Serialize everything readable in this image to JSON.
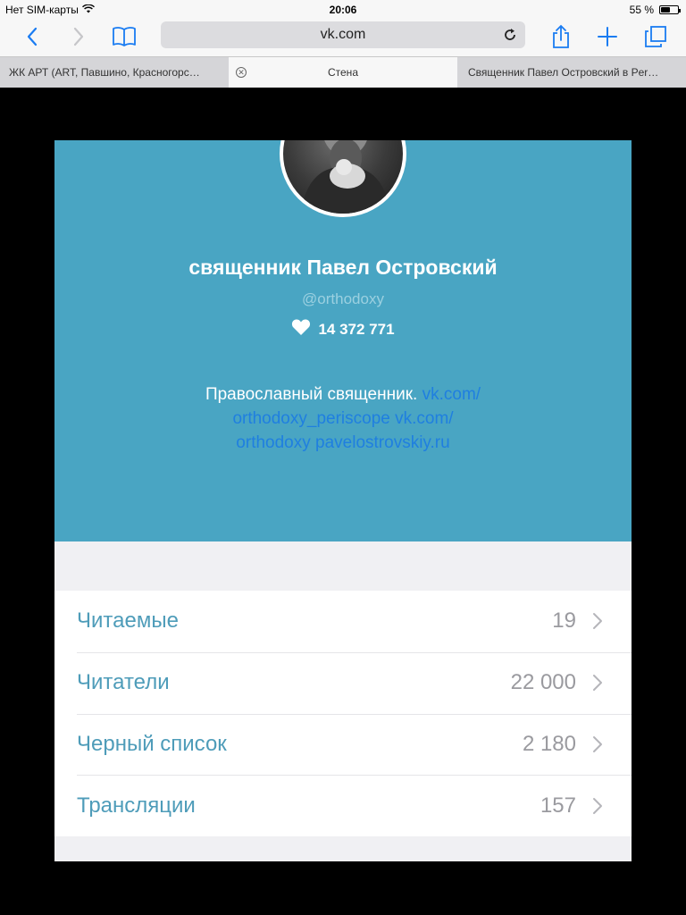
{
  "status_bar": {
    "carrier": "Нет SIM-карты",
    "time": "20:06",
    "battery_percent": "55 %",
    "battery_level": 0.55
  },
  "browser": {
    "url": "vk.com",
    "tabs": [
      {
        "title": "ЖК АРТ (ART, Павшино, Красногорс…",
        "state": "inactive"
      },
      {
        "title": "Стена",
        "state": "active"
      },
      {
        "title": "Священник Павел Островский в Per…",
        "state": "inactive"
      }
    ],
    "icons": {
      "back": "back-chevron-icon",
      "forward": "forward-chevron-icon",
      "bookmarks": "bookmarks-book-icon",
      "reload": "reload-icon",
      "share": "share-icon",
      "new_tab": "plus-icon",
      "tabs": "tabs-overview-icon"
    }
  },
  "profile": {
    "name": "священник Павел Островский",
    "handle": "@orthodoxy",
    "likes": "14 372 771",
    "bio_text": "Православный священник.",
    "bio_link1": "vk.com/",
    "bio_link2": "orthodoxy_periscope",
    "bio_link3": "vk.com/",
    "bio_link4": "orthodoxy",
    "bio_link5": "pavelostrovskiy.ru"
  },
  "stats": [
    {
      "label": "Читаемые",
      "value": "19"
    },
    {
      "label": "Читатели",
      "value": "22 000"
    },
    {
      "label": "Черный список",
      "value": "2 180"
    },
    {
      "label": "Трансляции",
      "value": "157"
    }
  ],
  "colors": {
    "header_bg": "#49a5c3",
    "link": "#1f7fe0",
    "stat_label": "#4e9cb9",
    "ios_blue": "#1a7cf2"
  }
}
